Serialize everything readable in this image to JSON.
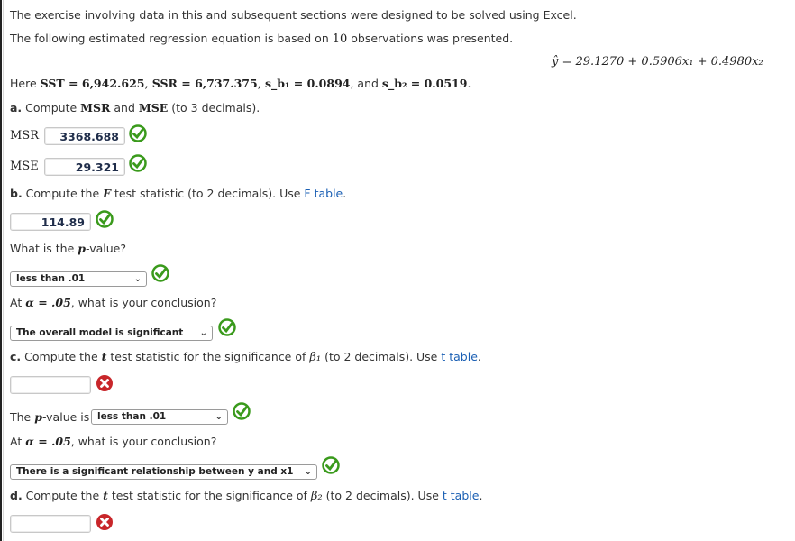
{
  "intro": {
    "line1": "The exercise involving data in this and subsequent sections were designed to be solved using Excel.",
    "line2_pre": "The following estimated regression equation is based on ",
    "line2_n": "10",
    "line2_post": " observations was presented."
  },
  "equation": "ŷ = 29.1270 + 0.5906x₁ + 0.4980x₂",
  "given": {
    "pre": "Here ",
    "sst": "SST = 6,942.625",
    "ssr": "SSR = 6,737.375",
    "sb1": "s_b₁ = 0.0894",
    "and": ", and ",
    "sb2": "s_b₂ = 0.0519",
    "end": "."
  },
  "part_a": {
    "letter": "a.",
    "prompt_pre": " Compute ",
    "msr_word": "MSR",
    "and": " and ",
    "mse_word": "MSE",
    "prompt_post": " (to 3 decimals).",
    "msr_label": "MSR",
    "msr_value": "3368.688",
    "msr_status": "correct",
    "mse_label": "MSE",
    "mse_value": "29.321",
    "mse_status": "correct"
  },
  "part_b": {
    "letter": "b.",
    "prompt_pre": " Compute the ",
    "stat": "F",
    "prompt_post": " test statistic (to 2 decimals). Use ",
    "link": "F table",
    "end": ".",
    "f_value": "114.89",
    "f_status": "correct",
    "pvalue_q_pre": "What is the ",
    "pvalue_q_p": "p",
    "pvalue_q_post": "-value?",
    "pvalue_select": "less than .01",
    "pvalue_status": "correct",
    "conclusion_q_pre": "At ",
    "conclusion_q_alpha": "α = .05",
    "conclusion_q_post": ", what is your conclusion?",
    "conclusion_select": "The overall model is significant",
    "conclusion_status": "correct"
  },
  "part_c": {
    "letter": "c.",
    "prompt_pre": " Compute the ",
    "stat": "t",
    "prompt_mid": " test statistic for the significance of ",
    "beta": "β₁",
    "prompt_post": " (to 2 decimals). Use ",
    "link": "t table",
    "end": ".",
    "t_value": "",
    "t_status": "incorrect",
    "pvalue_pre": "The ",
    "pvalue_p": "p",
    "pvalue_post": "-value is",
    "pvalue_select": "less than .01",
    "pvalue_status": "correct",
    "conclusion_q_pre": "At ",
    "conclusion_q_alpha": "α = .05",
    "conclusion_q_post": ", what is your conclusion?",
    "conclusion_select": "There is a significant relationship between y and x1",
    "conclusion_status": "correct"
  },
  "part_d": {
    "letter": "d.",
    "prompt_pre": " Compute the ",
    "stat": "t",
    "prompt_mid": " test statistic for the significance of ",
    "beta": "β₂",
    "prompt_post": " (to 2 decimals). Use ",
    "link": "t table",
    "end": ".",
    "t_value": "",
    "t_status": "incorrect"
  },
  "icons": {
    "correct": "green-check-circle",
    "incorrect": "red-x-circle"
  },
  "colors": {
    "correct": "#3a9a1c",
    "incorrect": "#c8262a",
    "link": "#1a5fb4"
  }
}
